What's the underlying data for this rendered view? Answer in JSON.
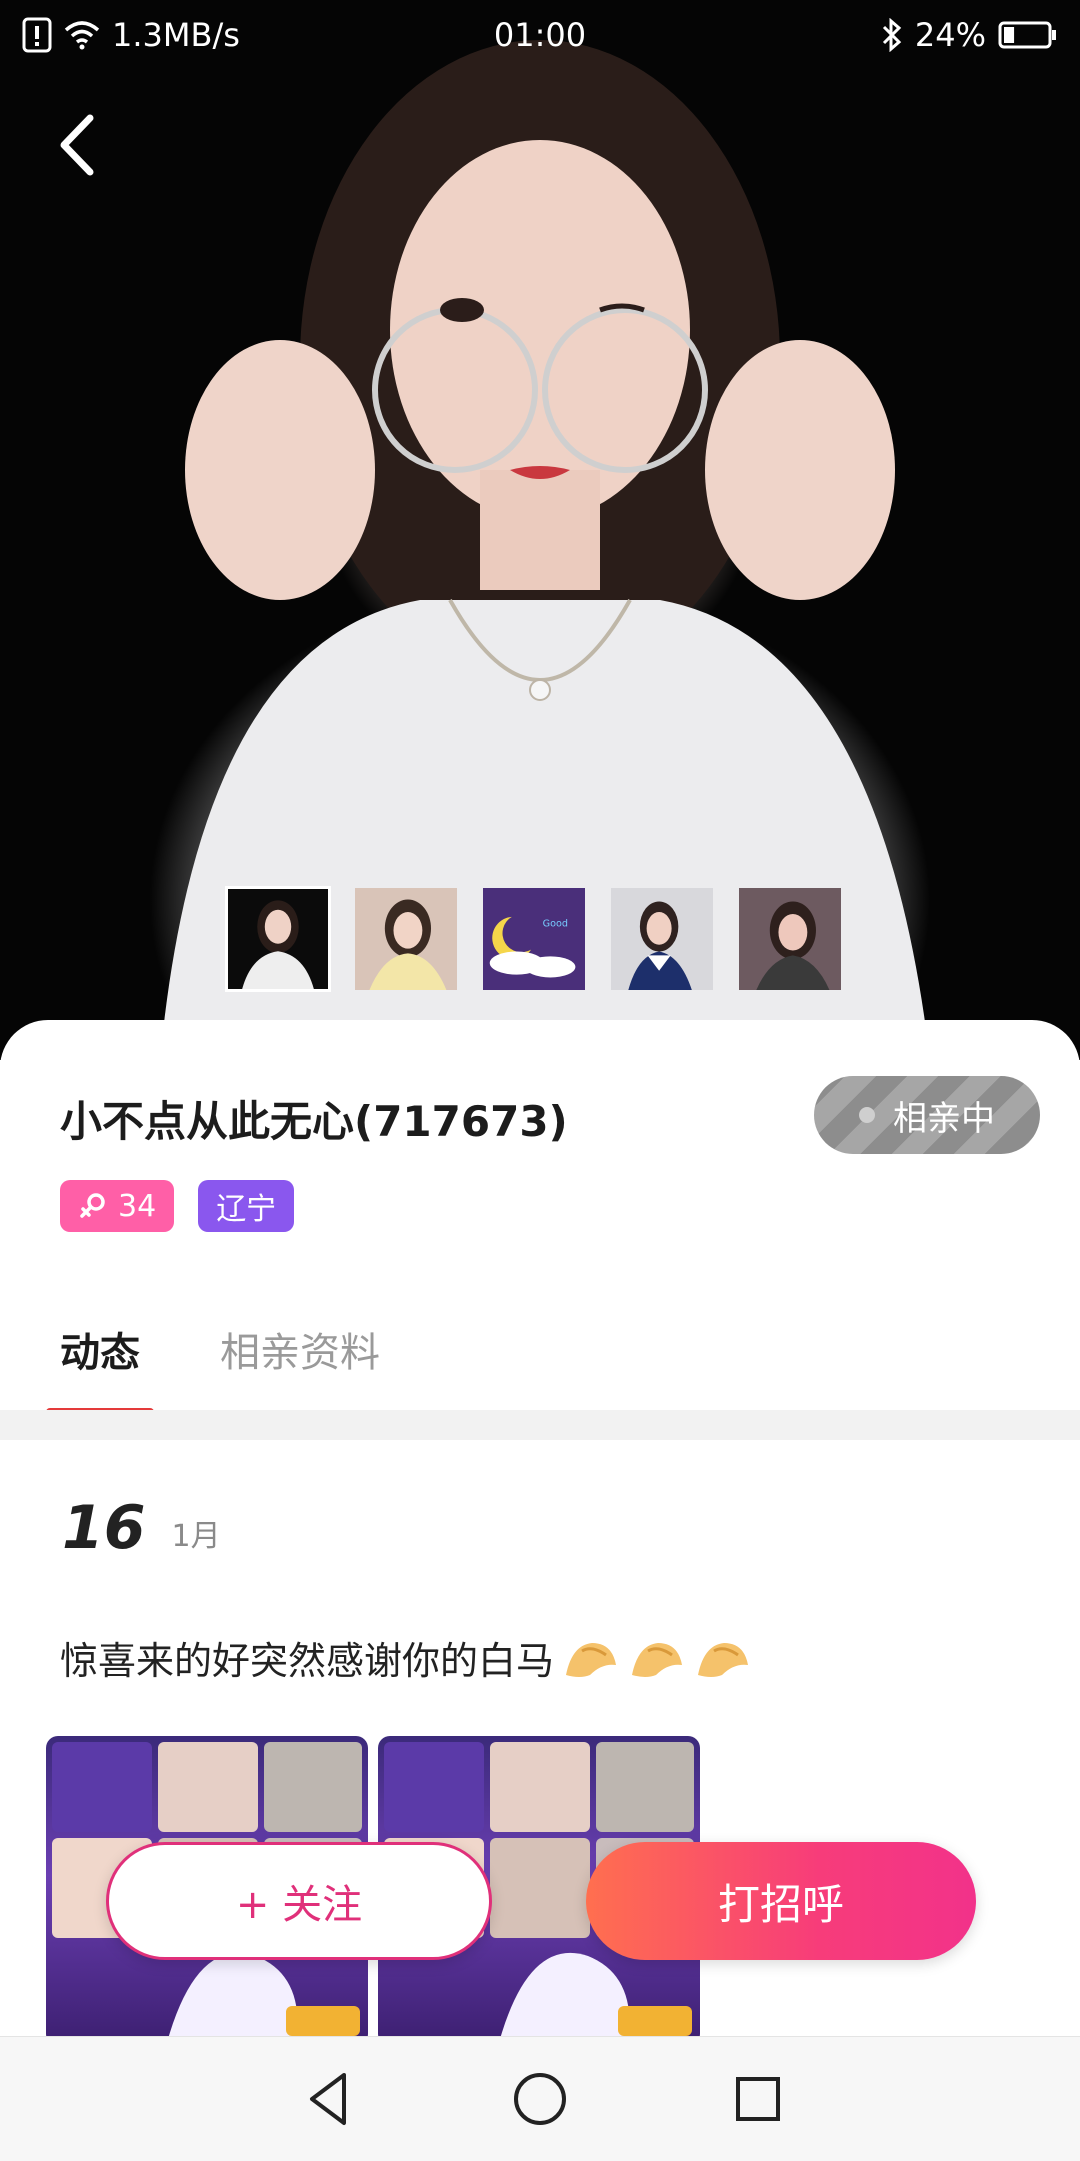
{
  "status_bar": {
    "network_speed": "1.3MB/s",
    "time": "01:00",
    "battery_percent": "24%",
    "battery_level": 0.24
  },
  "profile": {
    "nickname": "小不点从此无心(717673)",
    "status": "相亲中",
    "age": "34",
    "location": "辽宁"
  },
  "tabs": [
    {
      "label": "动态",
      "active": true
    },
    {
      "label": "相亲资料",
      "active": false
    }
  ],
  "post": {
    "day": "16",
    "month": "1月",
    "text": "惊喜来的好突然感谢你的白马"
  },
  "buttons": {
    "follow": "+ 关注",
    "greet": "打招呼"
  },
  "colors": {
    "accent_pink": "#e0307a",
    "tab_underline": "#e43a3a",
    "age_tag": "#ff5fa7",
    "location_tag": "#8a57ee"
  }
}
